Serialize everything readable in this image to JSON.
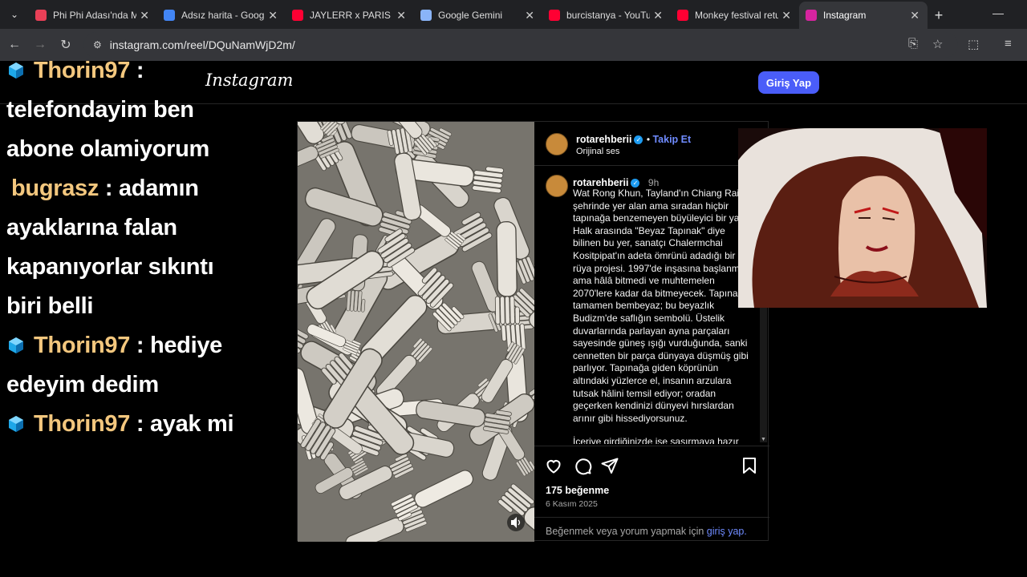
{
  "browser": {
    "tabs": [
      {
        "title": "Phi Phi Adası'nda Mu",
        "favicon_color": "#e94057",
        "active": false
      },
      {
        "title": "Adsız harita - Google",
        "favicon_color": "#4285f4",
        "active": false
      },
      {
        "title": "JAYLERR x PARIS - (Ai",
        "favicon_color": "#ff0033",
        "active": false
      },
      {
        "title": "Google Gemini",
        "favicon_color": "#8ab4f8",
        "active": false
      },
      {
        "title": "burcistanya - YouTub",
        "favicon_color": "#ff0033",
        "active": false
      },
      {
        "title": "Monkey festival retu",
        "favicon_color": "#ff0033",
        "active": false
      },
      {
        "title": "Instagram",
        "favicon_color": "#d6249f",
        "active": true
      }
    ],
    "url": "instagram.com/reel/DQuNamWjD2m/"
  },
  "chat": [
    {
      "user": "Thorin97",
      "cube": true,
      "text": "telefondayim ben abone olamiyorum"
    },
    {
      "user": "bugrasz",
      "cube": false,
      "text": "adamın ayaklarına falan kapanıyorlar sıkıntı biri belli"
    },
    {
      "user": "Thorin97",
      "cube": true,
      "text": "hediye edeyim dedim"
    },
    {
      "user": "Thorin97",
      "cube": true,
      "text": "ayak mi"
    }
  ],
  "instagram": {
    "logo": "Instagram",
    "login_button": "Giriş Yap",
    "post": {
      "username": "rotarehberii",
      "follow": "Takip Et",
      "audio": "Orijinal ses",
      "time_ago": "9h",
      "caption": "Wat Rong Khun, Tayland'ın Chiang Rai şehrinde yer alan ama sıradan hiçbir tapınağa benzemeyen büyüleyici bir yapı. Halk arasında \"Beyaz Tapınak\" diye bilinen bu yer, sanatçı Chalermchai Kositpipat'ın adeta ömrünü adadığı bir rüya projesi. 1997'de inşasına başlanmış ama hâlâ bitmedi ve muhtemelen 2070'lere kadar da bitmeyecek. Tapınak tamamen bembeyaz; bu beyazlık Budizm'de saflığın sembolü. Üstelik duvarlarında parlayan ayna parçaları sayesinde güneş ışığı vurduğunda, sanki cennetten bir parça dünyaya düşmüş gibi parlıyor. Tapınağa giden köprünün altındaki yüzlerce el, insanın arzulara tutsak hâlini temsil ediyor; oradan geçerken kendinizi dünyevi hırslardan arınır gibi hissediyorsunuz.",
      "caption_more": "İçeriye girdiğinizde ise şaşırmaya hazır",
      "likes": "175 beğenme",
      "date": "6 Kasım 2025",
      "login_prompt_text": "Beğenmek veya yorum yapmak için",
      "login_prompt_link": "giriş yap."
    }
  }
}
